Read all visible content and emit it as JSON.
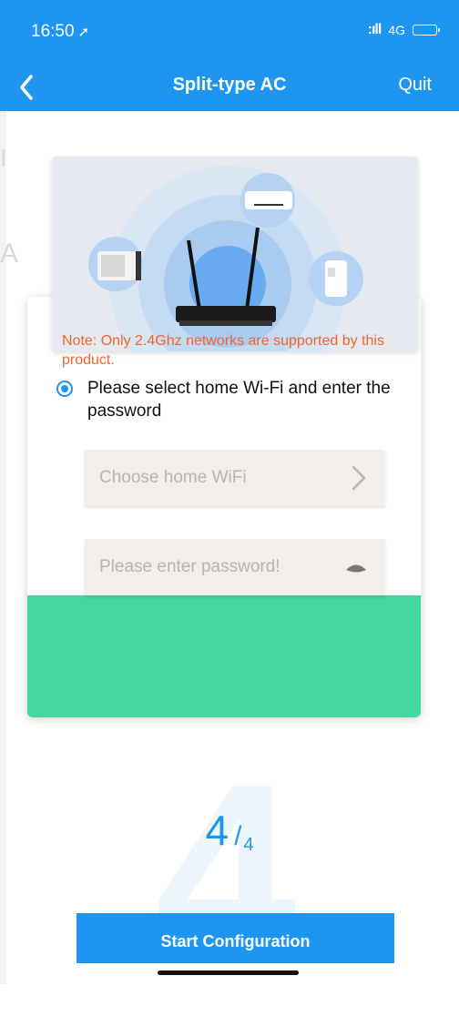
{
  "status_bar": {
    "time": "16:50",
    "location_glyph": "➚",
    "signal": ":ıll",
    "network": "4G"
  },
  "nav": {
    "title": "Split-type AC",
    "quit_label": "Quit"
  },
  "instruction": "Please select home Wi-Fi and enter the password",
  "wifi_field": {
    "placeholder": "Choose home WiFi"
  },
  "password_field": {
    "placeholder": "Please enter password!"
  },
  "note": "Note: Only 2.4Ghz networks are supported by this product.",
  "step": {
    "current": "4",
    "separator": "/",
    "total": "4"
  },
  "start_button_label": "Start Configuration",
  "colors": {
    "primary": "#1e96f0",
    "green_panel": "#46d7a0",
    "note_text": "#f0642d"
  },
  "icons": {
    "back": "chevron-left-icon",
    "wifi_arrow": "chevron-right-icon",
    "password_toggle": "eye-icon",
    "radio": "radio-selected-icon"
  }
}
